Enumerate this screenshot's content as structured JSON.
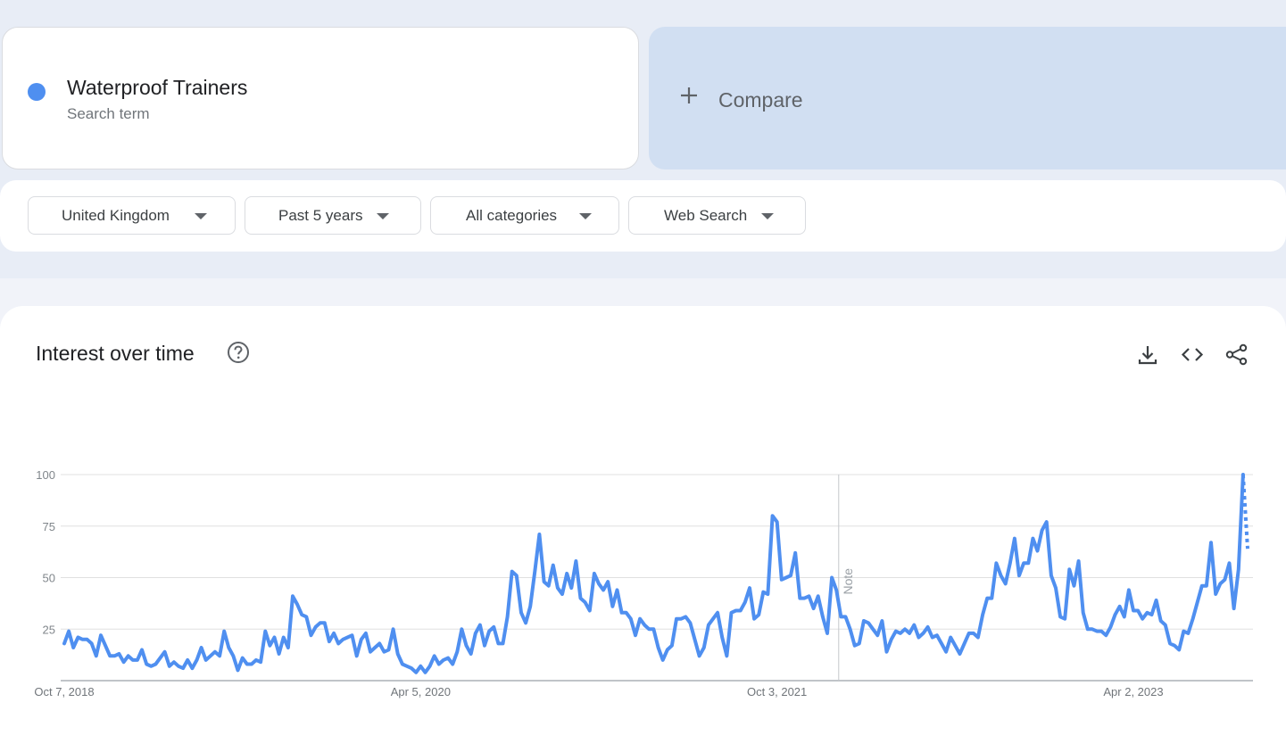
{
  "term": {
    "title": "Waterproof Trainers",
    "subtitle": "Search term",
    "color": "#4f8ff0"
  },
  "compare": {
    "label": "Compare",
    "icon": "plus-icon"
  },
  "filters": [
    {
      "label": "United Kingdom",
      "icon": "caret-down-icon"
    },
    {
      "label": "Past 5 years",
      "icon": "caret-down-icon"
    },
    {
      "label": "All categories",
      "icon": "caret-down-icon"
    },
    {
      "label": "Web Search",
      "icon": "caret-down-icon"
    }
  ],
  "panel": {
    "title": "Interest over time",
    "icons": [
      "help-icon",
      "download-icon",
      "embed-code-icon",
      "share-icon"
    ]
  },
  "chart_data": {
    "type": "line",
    "title": "",
    "xlabel": "",
    "ylabel": "",
    "ylim": [
      0,
      100
    ],
    "yticks": [
      "100",
      "75",
      "50",
      "25"
    ],
    "xticks": [
      "Oct 7, 2018",
      "Apr 5, 2020",
      "Oct 3, 2021",
      "Apr 2, 2023"
    ],
    "note_label": "Note",
    "grid": true,
    "legend": "none",
    "series": [
      {
        "color": "#4f8ff0",
        "values": [
          18,
          24,
          16,
          21,
          20,
          20,
          18,
          12,
          22,
          17,
          12,
          12,
          13,
          9,
          12,
          10,
          10,
          15,
          8,
          7,
          8,
          11,
          14,
          7,
          9,
          7,
          6,
          10,
          6,
          10,
          16,
          10,
          12,
          14,
          12,
          24,
          16,
          12,
          5,
          11,
          8,
          8,
          10,
          9,
          24,
          17,
          21,
          13,
          21,
          16,
          41,
          37,
          32,
          31,
          22,
          26,
          28,
          28,
          19,
          23,
          18,
          20,
          21,
          22,
          12,
          20,
          23,
          14,
          16,
          18,
          14,
          15,
          25,
          13,
          8,
          7,
          6,
          4,
          7,
          4,
          7,
          12,
          8,
          10,
          11,
          8,
          14,
          25,
          17,
          13,
          23,
          27,
          17,
          24,
          26,
          18,
          18,
          31,
          53,
          51,
          33,
          28,
          36,
          53,
          71,
          48,
          46,
          56,
          45,
          42,
          52,
          45,
          58,
          40,
          38,
          34,
          52,
          47,
          44,
          48,
          36,
          44,
          33,
          33,
          30,
          22,
          30,
          27,
          25,
          25,
          16,
          10,
          15,
          17,
          30,
          30,
          31,
          28,
          20,
          12,
          16,
          27,
          30,
          33,
          21,
          12,
          33,
          34,
          34,
          38,
          45,
          30,
          32,
          43,
          42,
          80,
          77,
          49,
          50,
          51,
          62,
          40,
          40,
          41,
          35,
          41,
          31,
          23,
          50,
          44,
          31,
          31,
          25,
          17,
          18,
          29,
          28,
          25,
          22,
          29,
          14,
          20,
          24,
          23,
          25,
          23,
          27,
          21,
          23,
          26,
          21,
          22,
          18,
          14,
          21,
          17,
          13,
          18,
          23,
          23,
          21,
          32,
          40,
          40,
          57,
          51,
          47,
          57,
          69,
          51,
          57,
          57,
          69,
          63,
          73,
          77,
          51,
          45,
          31,
          30,
          54,
          46,
          58,
          33,
          25,
          25,
          24,
          24,
          22,
          26,
          32,
          36,
          31,
          44,
          34,
          34,
          30,
          33,
          32,
          39,
          29,
          27,
          18,
          17,
          15,
          24,
          23,
          30,
          38,
          46,
          46,
          67,
          42,
          47,
          49,
          57,
          35,
          54,
          100,
          64
        ]
      }
    ]
  }
}
